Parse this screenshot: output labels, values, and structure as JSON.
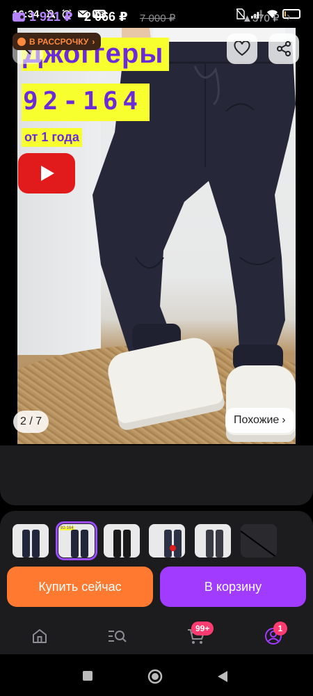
{
  "status_bar": {
    "time": "16:34",
    "battery": "9",
    "battery_level": 0.09,
    "left_icons": [
      "dnd-crossed-icon",
      "alarm-icon",
      "mail-icon",
      "wb-app-icon"
    ],
    "wb_label": "WB",
    "right_icons": [
      "no-sim-icon",
      "signal-icon",
      "wifi-icon",
      "battery-icon"
    ]
  },
  "product_image": {
    "overlay_title": "Джоггеры",
    "overlay_sizes": "92-164",
    "overlay_age": "от 1 года",
    "counter": "2 / 7",
    "similar_label": "Похожие",
    "similar_chevron": "›"
  },
  "price": {
    "wallet_price": "1 921 ₽",
    "price": "2 066 ₽",
    "old_price": "7 000 ₽",
    "difference": "▲370 ₽",
    "chevron": "›",
    "installment_label": "В РАССРОЧКУ",
    "installment_chevron": "›"
  },
  "thumbnails": [
    {
      "label": ""
    },
    {
      "label": "92-164"
    },
    {
      "label": ""
    },
    {
      "label": ""
    },
    {
      "label": ""
    },
    {
      "label": ""
    }
  ],
  "actions": {
    "buy_now": "Купить сейчас",
    "add_to_cart": "В корзину"
  },
  "bottom_nav": {
    "items": [
      "home-icon",
      "catalog-search-icon",
      "cart-icon",
      "profile-icon"
    ],
    "cart_badge": "99+",
    "profile_badge": "1"
  },
  "colors": {
    "accent_purple": "#a13bff",
    "buy_orange": "#ff7a30",
    "overlay_yellow": "#f8ff2e",
    "overlay_text": "#6c2bd9",
    "wallet_price": "#b583ff"
  }
}
